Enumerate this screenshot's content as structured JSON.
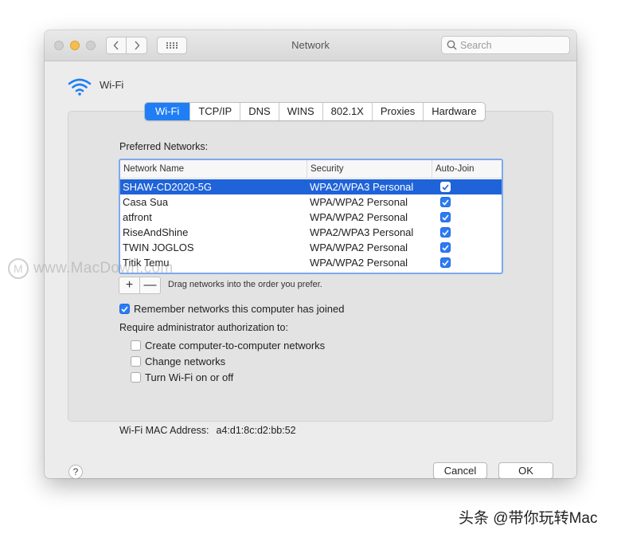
{
  "window": {
    "title": "Network",
    "search_placeholder": "Search"
  },
  "header": {
    "label": "Wi-Fi",
    "icon": "wifi-icon"
  },
  "tabs": [
    {
      "label": "Wi-Fi",
      "active": true
    },
    {
      "label": "TCP/IP",
      "active": false
    },
    {
      "label": "DNS",
      "active": false
    },
    {
      "label": "WINS",
      "active": false
    },
    {
      "label": "802.1X",
      "active": false
    },
    {
      "label": "Proxies",
      "active": false
    },
    {
      "label": "Hardware",
      "active": false
    }
  ],
  "preferred": {
    "title": "Preferred Networks:",
    "columns": {
      "name": "Network Name",
      "security": "Security",
      "auto_join": "Auto-Join"
    },
    "rows": [
      {
        "name": "SHAW-CD2020-5G",
        "security": "WPA2/WPA3 Personal",
        "auto_join": true,
        "selected": true
      },
      {
        "name": "Casa Sua",
        "security": "WPA/WPA2 Personal",
        "auto_join": true,
        "selected": false
      },
      {
        "name": "atfront",
        "security": "WPA/WPA2 Personal",
        "auto_join": true,
        "selected": false
      },
      {
        "name": "RiseAndShine",
        "security": "WPA2/WPA3 Personal",
        "auto_join": true,
        "selected": false
      },
      {
        "name": "TWIN JOGLOS",
        "security": "WPA/WPA2 Personal",
        "auto_join": true,
        "selected": false
      },
      {
        "name": "Titik Temu",
        "security": "WPA/WPA2 Personal",
        "auto_join": true,
        "selected": false
      }
    ],
    "add_label": "+",
    "remove_label": "—",
    "drag_hint": "Drag networks into the order you prefer."
  },
  "options": {
    "remember": {
      "label": "Remember networks this computer has joined",
      "checked": true
    },
    "require_title": "Require administrator authorization to:",
    "create": {
      "label": "Create computer-to-computer networks",
      "checked": false
    },
    "change": {
      "label": "Change networks",
      "checked": false
    },
    "toggle": {
      "label": "Turn Wi-Fi on or off",
      "checked": false
    }
  },
  "mac": {
    "label": "Wi-Fi MAC Address:",
    "value": "a4:d1:8c:d2:bb:52"
  },
  "footer": {
    "help_label": "?",
    "cancel_label": "Cancel",
    "ok_label": "OK"
  },
  "watermark": {
    "logo_letter": "M",
    "text": "www.MacDown.com"
  },
  "caption": "头条 @带你玩转Mac",
  "colors": {
    "accent": "#1f7ef6",
    "selection": "#1f63d8",
    "wifi": "#1f7ef6"
  }
}
